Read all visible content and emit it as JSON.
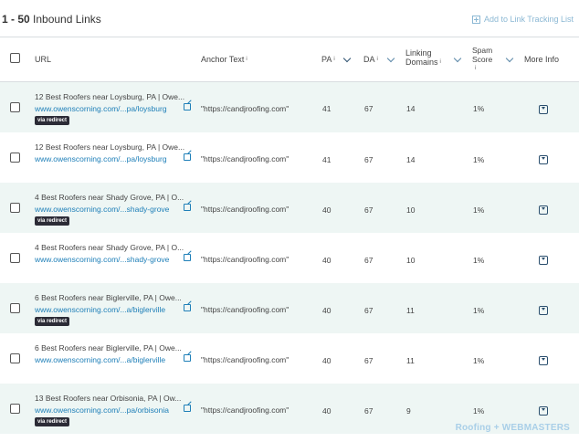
{
  "header": {
    "range": "1 - 50",
    "title": "Inbound Links",
    "add_tracking": "Add to Link Tracking List"
  },
  "columns": {
    "url": "URL",
    "anchor": "Anchor Text",
    "pa": "PA",
    "da": "DA",
    "linking_domains_line1": "Linking",
    "linking_domains_line2": "Domains",
    "spam_line1": "Spam",
    "spam_line2": "Score",
    "more": "More Info",
    "info_mark": "i"
  },
  "rows": [
    {
      "title": "12 Best Roofers near Loysburg, PA | Owe...",
      "url": "www.owenscorning.com/...pa/loysburg",
      "redirect": "via redirect",
      "anchor": "\"https://candjroofing.com\"",
      "pa": "41",
      "da": "67",
      "ld": "14",
      "spam": "1%"
    },
    {
      "title": "12 Best Roofers near Loysburg, PA | Owe...",
      "url": "www.owenscorning.com/...pa/loysburg",
      "redirect": "",
      "anchor": "\"https://candjroofing.com\"",
      "pa": "41",
      "da": "67",
      "ld": "14",
      "spam": "1%"
    },
    {
      "title": "4 Best Roofers near Shady Grove, PA | O...",
      "url": "www.owenscorning.com/...shady-grove",
      "redirect": "via redirect",
      "anchor": "\"https://candjroofing.com\"",
      "pa": "40",
      "da": "67",
      "ld": "10",
      "spam": "1%"
    },
    {
      "title": "4 Best Roofers near Shady Grove, PA | O...",
      "url": "www.owenscorning.com/...shady-grove",
      "redirect": "",
      "anchor": "\"https://candjroofing.com\"",
      "pa": "40",
      "da": "67",
      "ld": "10",
      "spam": "1%"
    },
    {
      "title": "6 Best Roofers near Biglerville, PA | Owe...",
      "url": "www.owenscorning.com/...a/biglerville",
      "redirect": "via redirect",
      "anchor": "\"https://candjroofing.com\"",
      "pa": "40",
      "da": "67",
      "ld": "11",
      "spam": "1%"
    },
    {
      "title": "6 Best Roofers near Biglerville, PA | Owe...",
      "url": "www.owenscorning.com/...a/biglerville",
      "redirect": "",
      "anchor": "\"https://candjroofing.com\"",
      "pa": "40",
      "da": "67",
      "ld": "11",
      "spam": "1%"
    },
    {
      "title": "13 Best Roofers near Orbisonia, PA | Ow...",
      "url": "www.owenscorning.com/...pa/orbisonia",
      "redirect": "via redirect",
      "anchor": "\"https://candjroofing.com\"",
      "pa": "40",
      "da": "67",
      "ld": "9",
      "spam": "1%"
    }
  ],
  "watermark": {
    "part1": "Roofing",
    "part2": "WEBMASTERS"
  },
  "colors": {
    "link": "#1e7fb8",
    "alt_row": "#eef6f4",
    "badge": "#2b2b36"
  }
}
